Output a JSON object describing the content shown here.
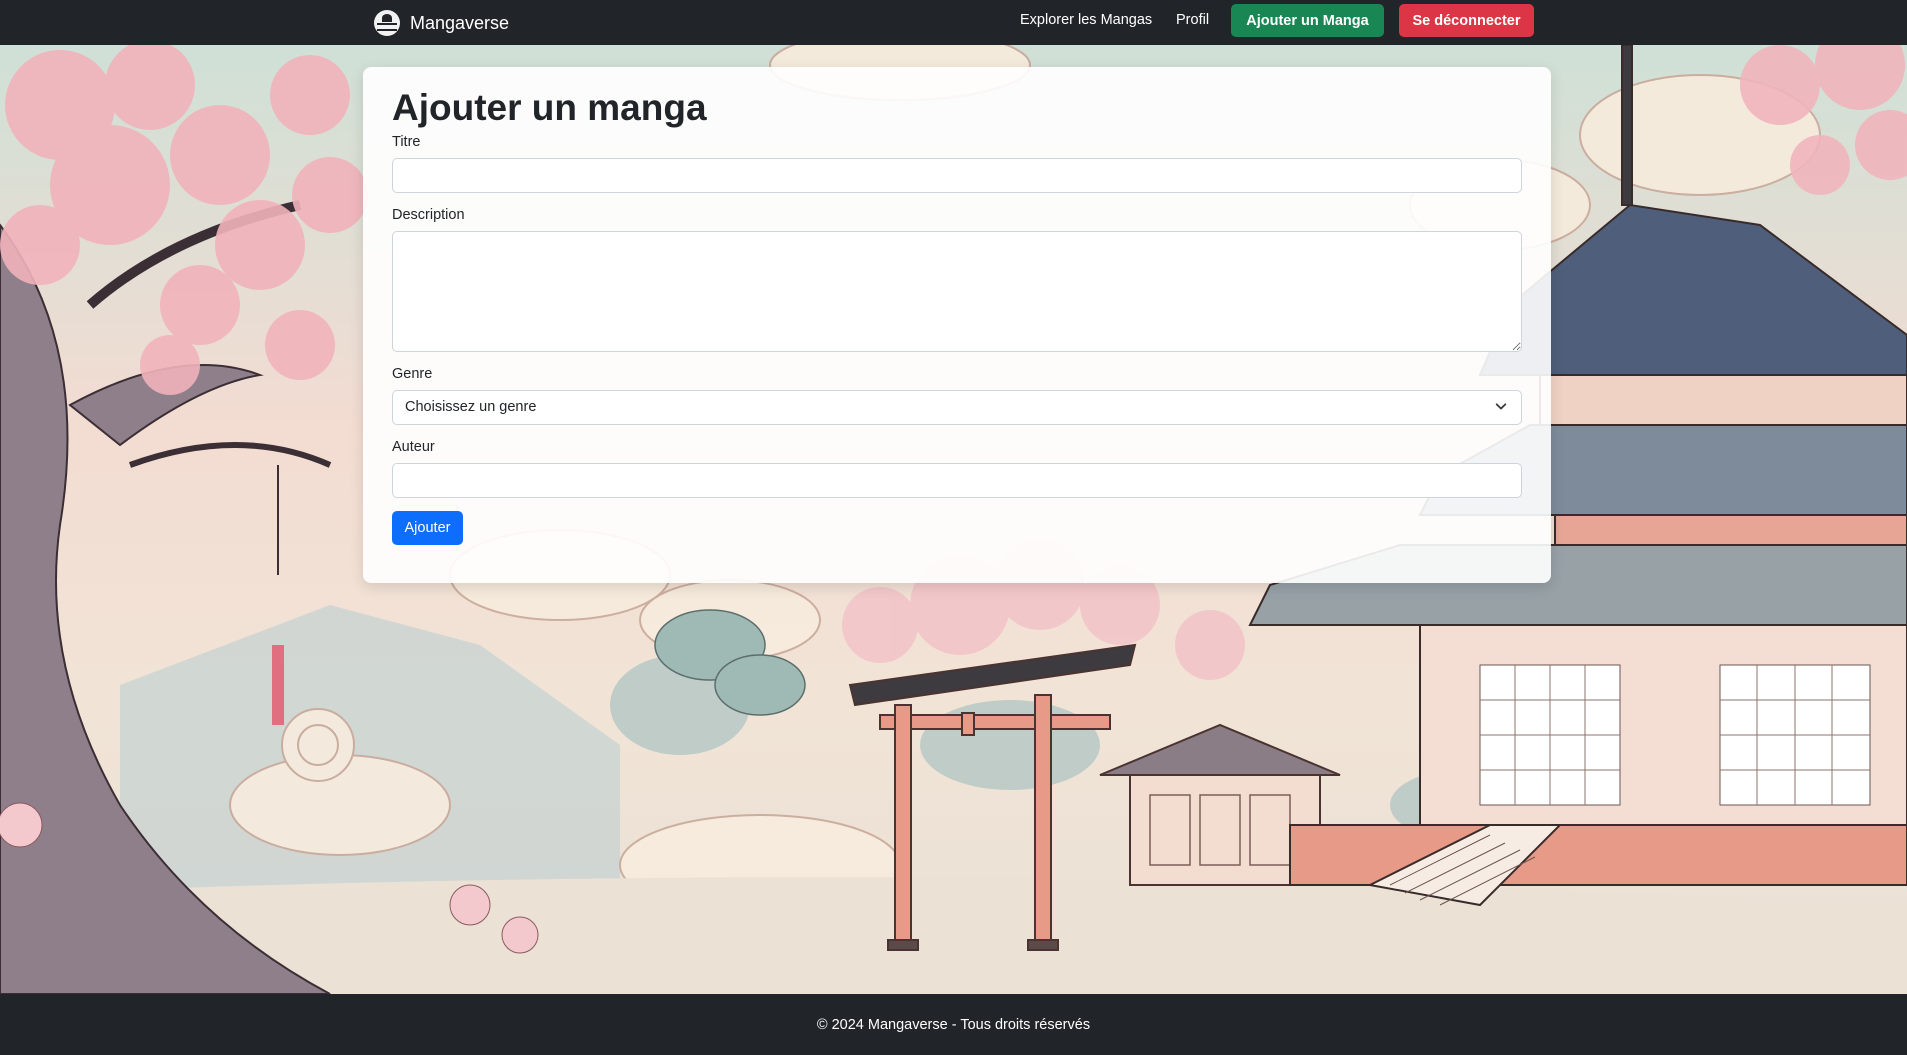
{
  "navbar": {
    "brand": "Mangaverse",
    "links": {
      "explore": "Explorer les Mangas",
      "profile": "Profil"
    },
    "add_manga_button": "Ajouter un Manga",
    "logout_button": "Se déconnecter"
  },
  "form": {
    "title": "Ajouter un manga",
    "fields": {
      "title_label": "Titre",
      "title_value": "",
      "description_label": "Description",
      "description_value": "",
      "genre_label": "Genre",
      "genre_selected": "Choisissez un genre",
      "author_label": "Auteur",
      "author_value": ""
    },
    "submit_label": "Ajouter"
  },
  "footer": {
    "text": "© 2024 Mangaverse - Tous droits réservés"
  },
  "colors": {
    "navbar_bg": "#212529",
    "success": "#198754",
    "danger": "#dc3545",
    "primary": "#0d6efd"
  }
}
